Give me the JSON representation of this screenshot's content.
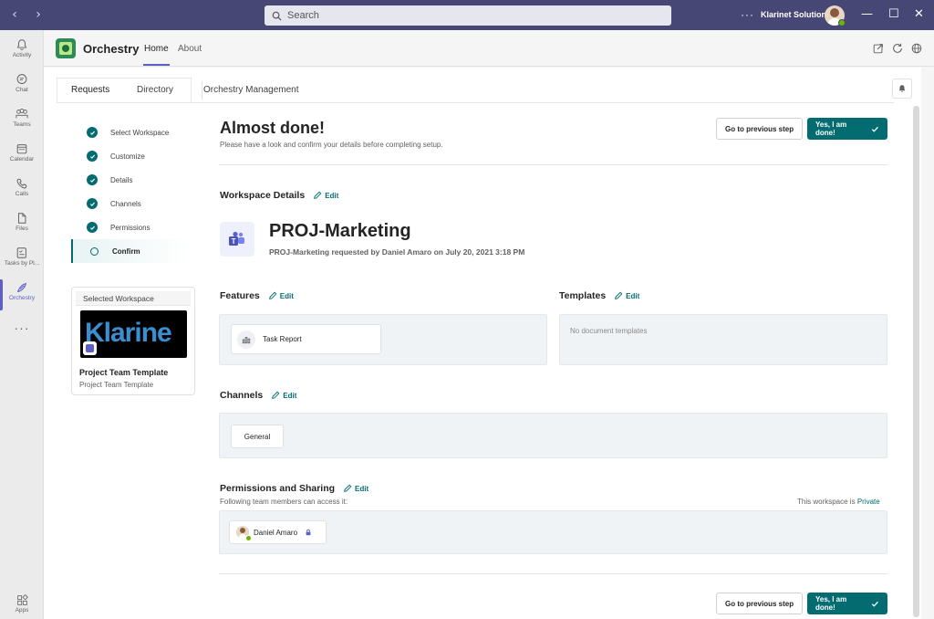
{
  "window": {
    "search_placeholder": "Search",
    "more": "···",
    "org_name": "Klarinet Solutions",
    "controls": {
      "minimize": "—",
      "maximize": "☐",
      "close": "✕"
    }
  },
  "rail": {
    "items": [
      {
        "label": "Activity",
        "icon": "bell-icon"
      },
      {
        "label": "Chat",
        "icon": "chat-icon"
      },
      {
        "label": "Teams",
        "icon": "teams-icon"
      },
      {
        "label": "Calendar",
        "icon": "calendar-icon"
      },
      {
        "label": "Calls",
        "icon": "phone-icon"
      },
      {
        "label": "Files",
        "icon": "file-icon"
      },
      {
        "label": "Tasks by Pl...",
        "icon": "tasks-icon"
      },
      {
        "label": "Orchestry",
        "icon": "orchestry-icon",
        "active": true
      }
    ],
    "more": "···",
    "apps_label": "Apps"
  },
  "app": {
    "name": "Orchestry",
    "tabs": [
      {
        "label": "Home",
        "active": true
      },
      {
        "label": "About"
      }
    ]
  },
  "request_tabs": [
    {
      "label": "Requests",
      "active": true
    },
    {
      "label": "Directory"
    },
    {
      "label": "Orchestry Management"
    }
  ],
  "steps": [
    {
      "label": "Select Workspace",
      "done": true
    },
    {
      "label": "Customize",
      "done": true
    },
    {
      "label": "Details",
      "done": true
    },
    {
      "label": "Channels",
      "done": true
    },
    {
      "label": "Permissions",
      "done": true
    },
    {
      "label": "Confirm",
      "current": true
    }
  ],
  "selected_workspace": {
    "header": "Selected Workspace",
    "image_text": "Klarine",
    "name": "Project Team Template",
    "subtitle": "Project Team Template"
  },
  "main": {
    "title": "Almost done!",
    "subtitle": "Please have a look and confirm your details before completing setup.",
    "prev_button": "Go to previous step",
    "confirm_button": "Yes, I am done!",
    "edit_label": "Edit",
    "workspace_details": {
      "heading": "Workspace Details",
      "name": "PROJ-Marketing",
      "requested_by": "PROJ-Marketing requested by Daniel Amaro on July 20, 2021 3:18 PM"
    },
    "features": {
      "heading": "Features",
      "items": [
        "Task Report"
      ]
    },
    "templates": {
      "heading": "Templates",
      "empty": "No document templates"
    },
    "channels": {
      "heading": "Channels",
      "items": [
        "General"
      ]
    },
    "permissions": {
      "heading": "Permissions and Sharing",
      "note": "Following team members can access it:",
      "privacy_prefix": "This workspace is",
      "privacy_value": "Private",
      "members": [
        "Daniel Amaro"
      ]
    }
  },
  "colors": {
    "accent": "#036c70",
    "titlebar": "#464775",
    "teams": "#5b5fc7"
  }
}
